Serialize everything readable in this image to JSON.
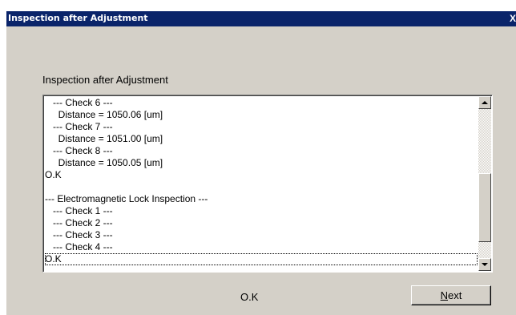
{
  "window": {
    "title": "Inspection after Adjustment",
    "close_glyph": "X"
  },
  "heading": "Inspection after Adjustment",
  "log_lines": [
    "   --- Check 6 ---",
    "     Distance = 1050.06 [um]",
    "   --- Check 7 ---",
    "     Distance = 1051.00 [um]",
    "   --- Check 8 ---",
    "     Distance = 1050.05 [um]",
    "O.K",
    "",
    "--- Electromagnetic Lock Inspection ---",
    "   --- Check 1 ---",
    "   --- Check 2 ---",
    "   --- Check 3 ---",
    "   --- Check 4 ---",
    "O.K"
  ],
  "selected_line_index": 13,
  "status_text": "O.K",
  "next_button": {
    "accel": "N",
    "rest": "ext"
  }
}
